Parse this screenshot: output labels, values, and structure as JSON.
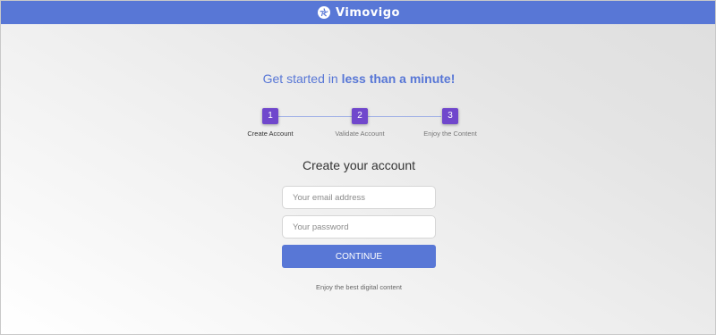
{
  "app": {
    "brand_name": "Vimovigo",
    "brand_icon": "aperture-icon",
    "accent_color": "#5877d6",
    "step_color": "#7047cc"
  },
  "headline": {
    "prefix": "Get started in ",
    "emphasis": "less than a minute!"
  },
  "steps": [
    {
      "number": "1",
      "label": "Create Account",
      "active": true
    },
    {
      "number": "2",
      "label": "Validate Account",
      "active": false
    },
    {
      "number": "3",
      "label": "Enjoy the Content",
      "active": false
    }
  ],
  "form": {
    "title": "Create your account",
    "email_placeholder": "Your email address",
    "email_value": "",
    "password_placeholder": "Your password",
    "password_value": "",
    "continue_label": "CONTINUE"
  },
  "footer": {
    "tagline": "Enjoy the best digital content"
  }
}
